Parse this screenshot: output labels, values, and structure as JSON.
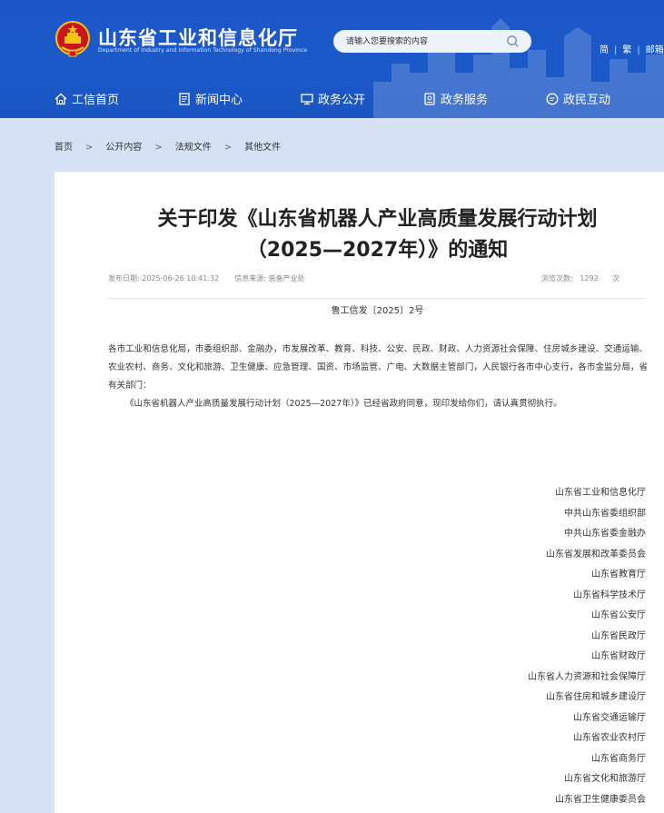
{
  "header": {
    "title": "山东省工业和信息化厅",
    "subtitle": "Department of Industry and Information Technology of Shandong Province",
    "search_placeholder": "请输入您要搜索的内容",
    "top_links": [
      "简",
      "繁",
      "邮箱"
    ]
  },
  "nav": {
    "items": [
      {
        "label": "工信首页",
        "icon": "home-icon"
      },
      {
        "label": "新闻中心",
        "icon": "document-icon"
      },
      {
        "label": "政务公开",
        "icon": "monitor-icon"
      },
      {
        "label": "政务服务",
        "icon": "service-icon"
      },
      {
        "label": "政民互动",
        "icon": "chat-icon"
      }
    ]
  },
  "breadcrumb": [
    "首页",
    "公开内容",
    "法规文件",
    "其他文件"
  ],
  "article": {
    "title_line1": "关于印发《山东省机器人产业高质量发展行动计划",
    "title_line2": "（2025—2027年）》的通知",
    "publish_label": "发布日期:",
    "publish_date": "2025-06-26 10:41:32",
    "source_label": "信息来源:",
    "source": "装备产业处",
    "views_label": "浏览次数:",
    "views_count": "1292",
    "views_unit": "次",
    "doc_number": "鲁工信发〔2025〕2号",
    "recipients": "各市工业和信息化局，市委组织部、金融办，市发展改革、教育、科技、公安、民政、财政、人力资源社会保障、住房城乡建设、交通运输、农业农村、商务、文化和旅游、卫生健康、应急管理、国资、市场监管、广电、大数据主管部门，人民银行各市中心支行，各市金监分局，省有关部门：",
    "paragraph1": "《山东省机器人产业高质量发展行动计划（2025—2027年）》已经省政府同意，现印发给你们，请认真贯彻执行。",
    "signers": [
      "山东省工业和信息化厅",
      "中共山东省委组织部",
      "中共山东省委金融办",
      "山东省发展和改革委员会",
      "山东省教育厅",
      "山东省科学技术厅",
      "山东省公安厅",
      "山东省民政厅",
      "山东省财政厅",
      "山东省人力资源和社会保障厅",
      "山东省住房和城乡建设厅",
      "山东省交通运输厅",
      "山东省农业农村厅",
      "山东省商务厅",
      "山东省文化和旅游厅",
      "山东省卫生健康委员会"
    ]
  },
  "colors": {
    "header_blue": "#1b59c9",
    "page_bg": "#d6e1f5",
    "emblem_red": "#c8161d",
    "emblem_gold": "#f3c316"
  }
}
